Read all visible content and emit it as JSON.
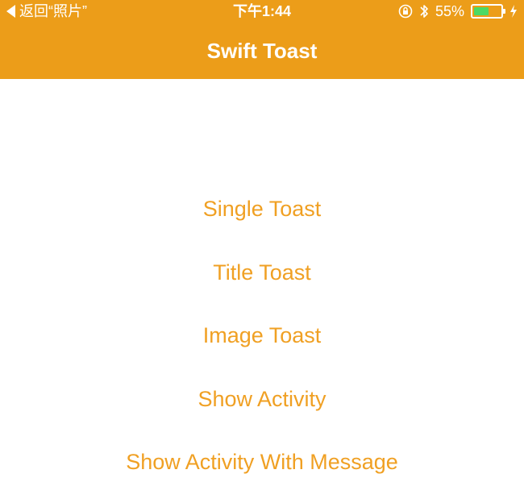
{
  "status_bar": {
    "back_label": "返回“照片”",
    "time": "下午1:44",
    "battery_percent_label": "55%",
    "battery_level": 0.55,
    "icons": [
      "back-caret-icon",
      "orientation-lock-icon",
      "bluetooth-icon",
      "battery-icon",
      "charging-bolt-icon"
    ]
  },
  "nav": {
    "title": "Swift Toast"
  },
  "menu": {
    "items": [
      {
        "label": "Single Toast"
      },
      {
        "label": "Title Toast"
      },
      {
        "label": "Image Toast"
      },
      {
        "label": "Show Activity"
      },
      {
        "label": "Show Activity With Message"
      }
    ]
  },
  "colors": {
    "header_bg": "#EC9D19",
    "accent_text": "#F0A023",
    "battery_fill": "#4CD964",
    "background": "#FFFFFF"
  }
}
